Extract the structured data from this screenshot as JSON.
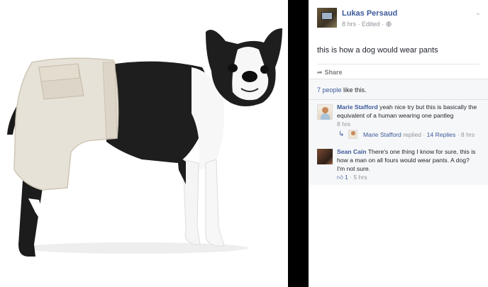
{
  "post": {
    "author": "Lukas Persaud",
    "meta": "8 hrs · Edited · ",
    "privacy_icon": "globe-icon",
    "menu_icon": "chevron-down-icon",
    "text": "this is how a dog would wear pants",
    "share_label": "Share"
  },
  "likes": {
    "count_text": "7 people",
    "suffix": " like this."
  },
  "comments": [
    {
      "author": "Marie Stafford",
      "text": " yeah nice try but this is basically the equivalent of a human wearing one pantleg",
      "time": "8 hrs",
      "reply": {
        "author": "Marie Stafford",
        "action": " replied · ",
        "count": "14 Replies",
        "time": " · 8 hrs"
      }
    },
    {
      "author": "Sean Cain",
      "text": " There's one thing I know for sure, this is how a man on all fours would wear pants. A dog? I'm not sure.",
      "like_count": "1",
      "time": " · 5 hrs"
    }
  ],
  "colors": {
    "link": "#3b5998",
    "divider": "#000000",
    "comment_bg": "#f6f7f9"
  }
}
